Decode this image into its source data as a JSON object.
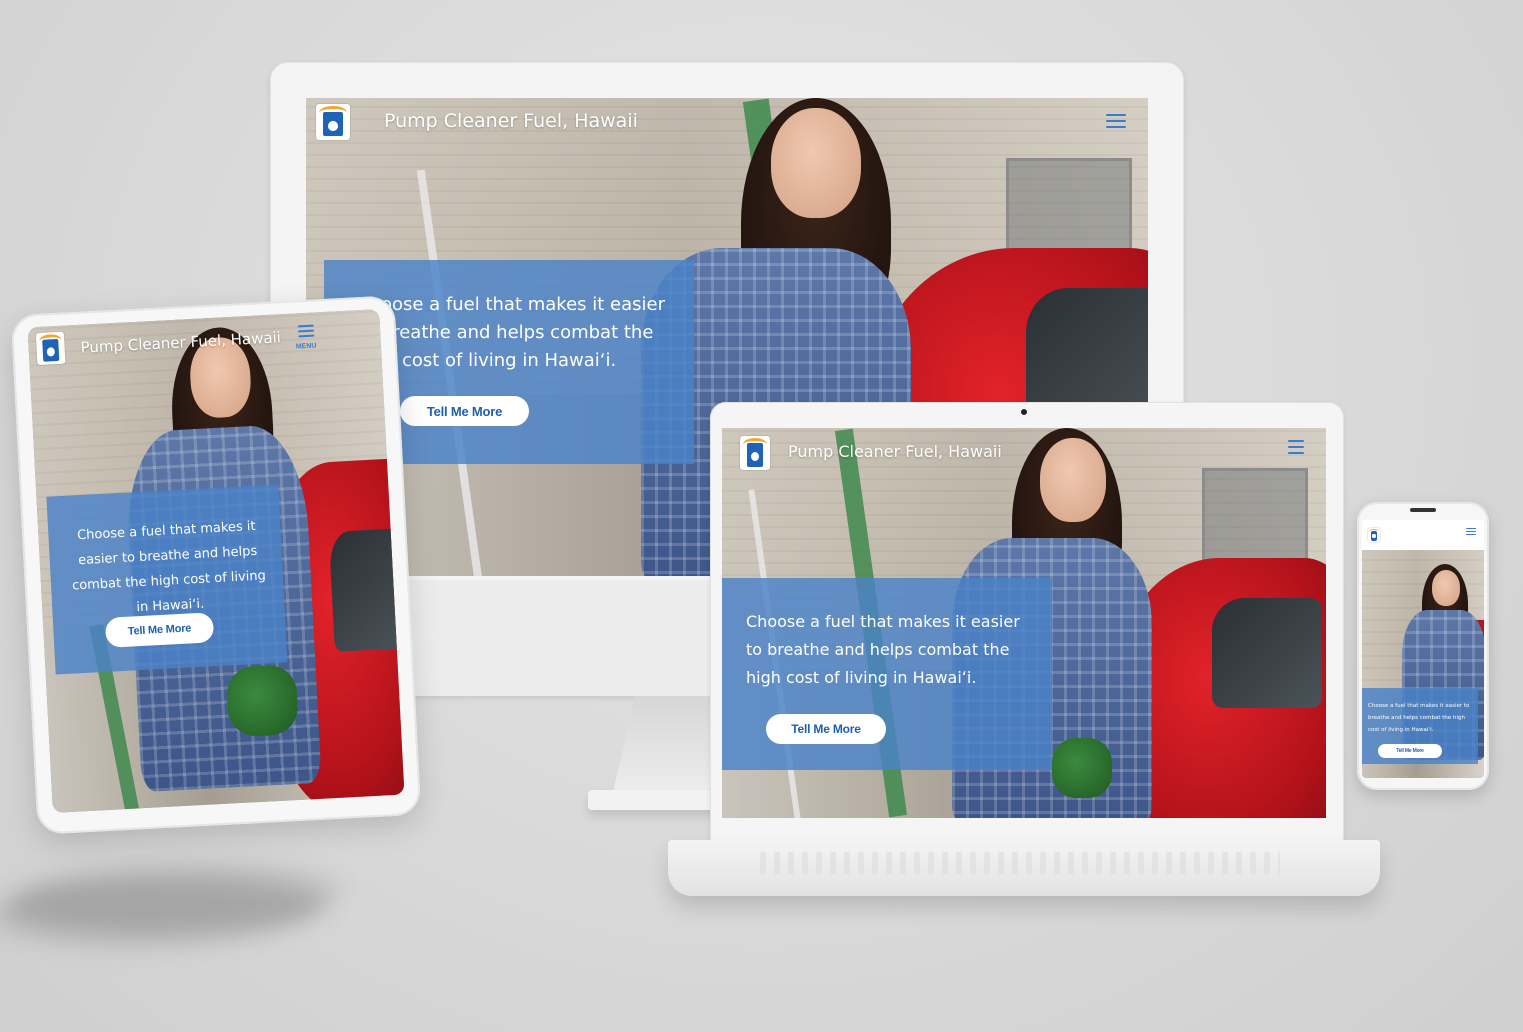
{
  "site": {
    "title": "Pump Cleaner Fuel, Hawaii",
    "hero_message": "Choose a fuel that makes it easier to breathe and helps combat the high cost of living in Hawaiʻi.",
    "cta_label": "Tell Me More",
    "menu_label": "MENU"
  },
  "colors": {
    "overlay_blue": "#4a83c8",
    "cta_text": "#1f5fb0",
    "logo_blue": "#1e63b8",
    "logo_orange": "#f4a52a"
  },
  "icons": {
    "logo": "fuel-pump-logo-icon",
    "menu": "hamburger-menu-icon"
  }
}
